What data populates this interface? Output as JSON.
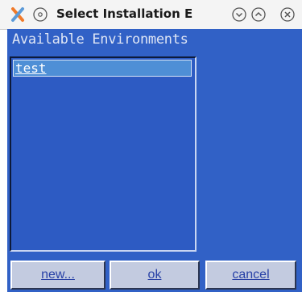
{
  "window": {
    "title": "Select Installation E"
  },
  "titlebar": {
    "icons": [
      "app-logo-icon",
      "minimize-circle-icon",
      "chevron-down-icon",
      "chevron-up-icon",
      "close-icon"
    ]
  },
  "environments": {
    "label": "Available Environments",
    "items": [
      {
        "label": "test",
        "selected": true
      }
    ]
  },
  "buttons": {
    "new_label": "new...",
    "ok_label": "ok",
    "cancel_label": "cancel"
  },
  "colors": {
    "body_background": "#3161c6",
    "selection": "#4e8fd6",
    "button_face": "#c3cbe0",
    "button_text": "#2841a6"
  }
}
